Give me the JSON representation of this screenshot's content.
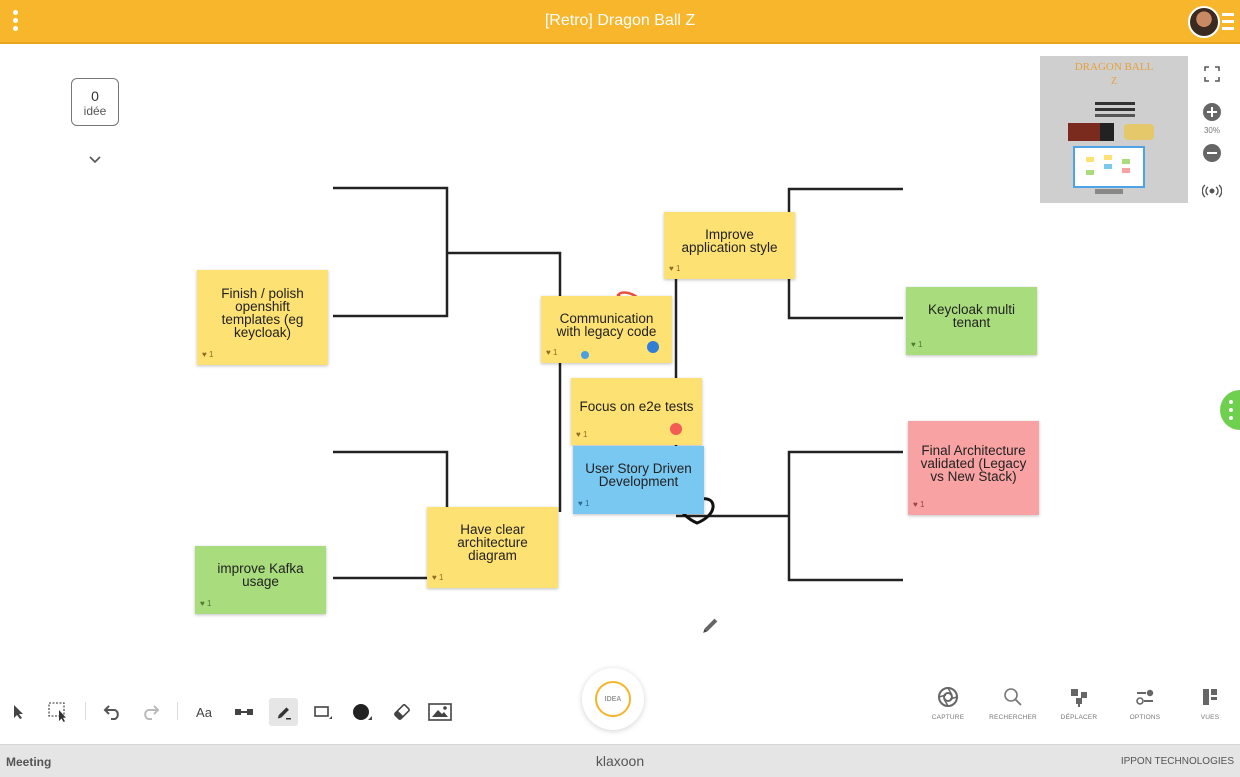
{
  "header": {
    "title": "[Retro] Dragon Ball Z"
  },
  "counter": {
    "count": "0",
    "label": "idée"
  },
  "board": {
    "stickies": [
      {
        "id": "finish-polish",
        "text": "Finish / polish openshift templates (eg keycloak)",
        "color": "yellow",
        "likes": "1"
      },
      {
        "id": "communication",
        "text": "Communication with legacy code",
        "color": "yellow",
        "likes": "1"
      },
      {
        "id": "improve-style",
        "text": "Improve application style",
        "color": "yellow",
        "likes": "1"
      },
      {
        "id": "keycloak",
        "text": "Keycloak multi tenant",
        "color": "green",
        "likes": "1"
      },
      {
        "id": "focus-e2e",
        "text": "Focus on e2e tests",
        "color": "yellow",
        "likes": "1"
      },
      {
        "id": "user-story",
        "text": "User Story Driven Development",
        "color": "blue",
        "likes": "1"
      },
      {
        "id": "final-arch",
        "text": "Final Architecture validated (Legacy vs New Stack)",
        "color": "pink",
        "likes": "1"
      },
      {
        "id": "clear-arch",
        "text": "Have clear architecture diagram",
        "color": "yellow",
        "likes": "1"
      },
      {
        "id": "kafka",
        "text": "improve Kafka usage",
        "color": "green",
        "likes": "1"
      }
    ],
    "dots": [
      {
        "color": "#4a9fe0"
      },
      {
        "color": "#2f7fd6"
      },
      {
        "color": "#f25c54"
      }
    ]
  },
  "minimap": {
    "zoom": "30%"
  },
  "toolbar": {
    "idea_label": "IDEA",
    "text_tool": "Aa",
    "right_tools": [
      {
        "label": "CAPTURE",
        "icon": "aperture-icon"
      },
      {
        "label": "RECHERCHER",
        "icon": "search-icon"
      },
      {
        "label": "DÉPLACER",
        "icon": "move-icon"
      },
      {
        "label": "OPTIONS",
        "icon": "options-icon"
      },
      {
        "label": "VUES",
        "icon": "views-icon"
      }
    ]
  },
  "footer": {
    "left": "Meeting",
    "center": "klaxoon",
    "right": "IPPON TECHNOLOGIES"
  },
  "colors": {
    "topbar": "#f8b62c",
    "yellow": "#fde172",
    "green": "#a8dc7c",
    "blue": "#79c8f2",
    "pink": "#f9a2a3"
  }
}
